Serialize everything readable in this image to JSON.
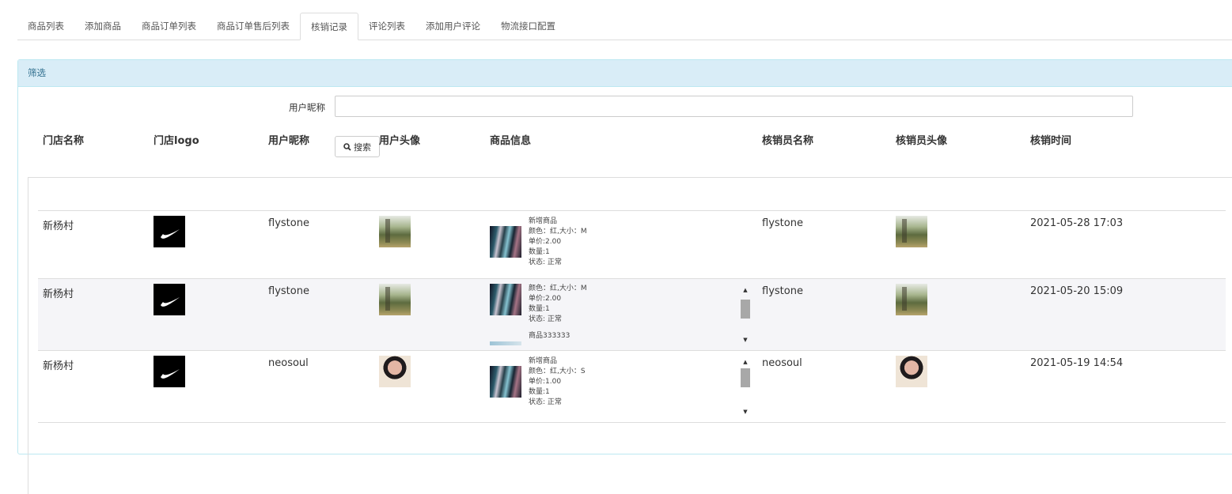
{
  "tabs": [
    "商品列表",
    "添加商品",
    "商品订单列表",
    "商品订单售后列表",
    "核销记录",
    "评论列表",
    "添加用户评论",
    "物流接口配置"
  ],
  "active_tab": "核销记录",
  "filter": {
    "title": "筛选",
    "nickname_label": "用户昵称",
    "nickname_value": "",
    "search_label": "搜索"
  },
  "table": {
    "headers": [
      "门店名称",
      "门店logo",
      "用户昵称",
      "用户头像",
      "商品信息",
      "核销员名称",
      "核销员头像",
      "核销时间"
    ],
    "rows": [
      {
        "store": "新杨村",
        "nickname": "flystone",
        "goods": [
          "新增商品\n颜色：红,大小：M\n单价:2.00\n数量:1\n状态: 正常"
        ],
        "verifier": "flystone",
        "time": "2021-05-28 17:03"
      },
      {
        "store": "新杨村",
        "nickname": "flystone",
        "goods": [
          "颜色：红,大小：M\n单价:2.00\n数量:1\n状态: 正常",
          "商品333333"
        ],
        "verifier": "flystone",
        "time": "2021-05-20 15:09"
      },
      {
        "store": "新杨村",
        "nickname": "neosoul",
        "goods": [
          "新增商品\n颜色：红,大小：S\n单价:1.00\n数量:1\n状态: 正常"
        ],
        "verifier": "neosoul",
        "time": "2021-05-19 14:54"
      }
    ]
  }
}
